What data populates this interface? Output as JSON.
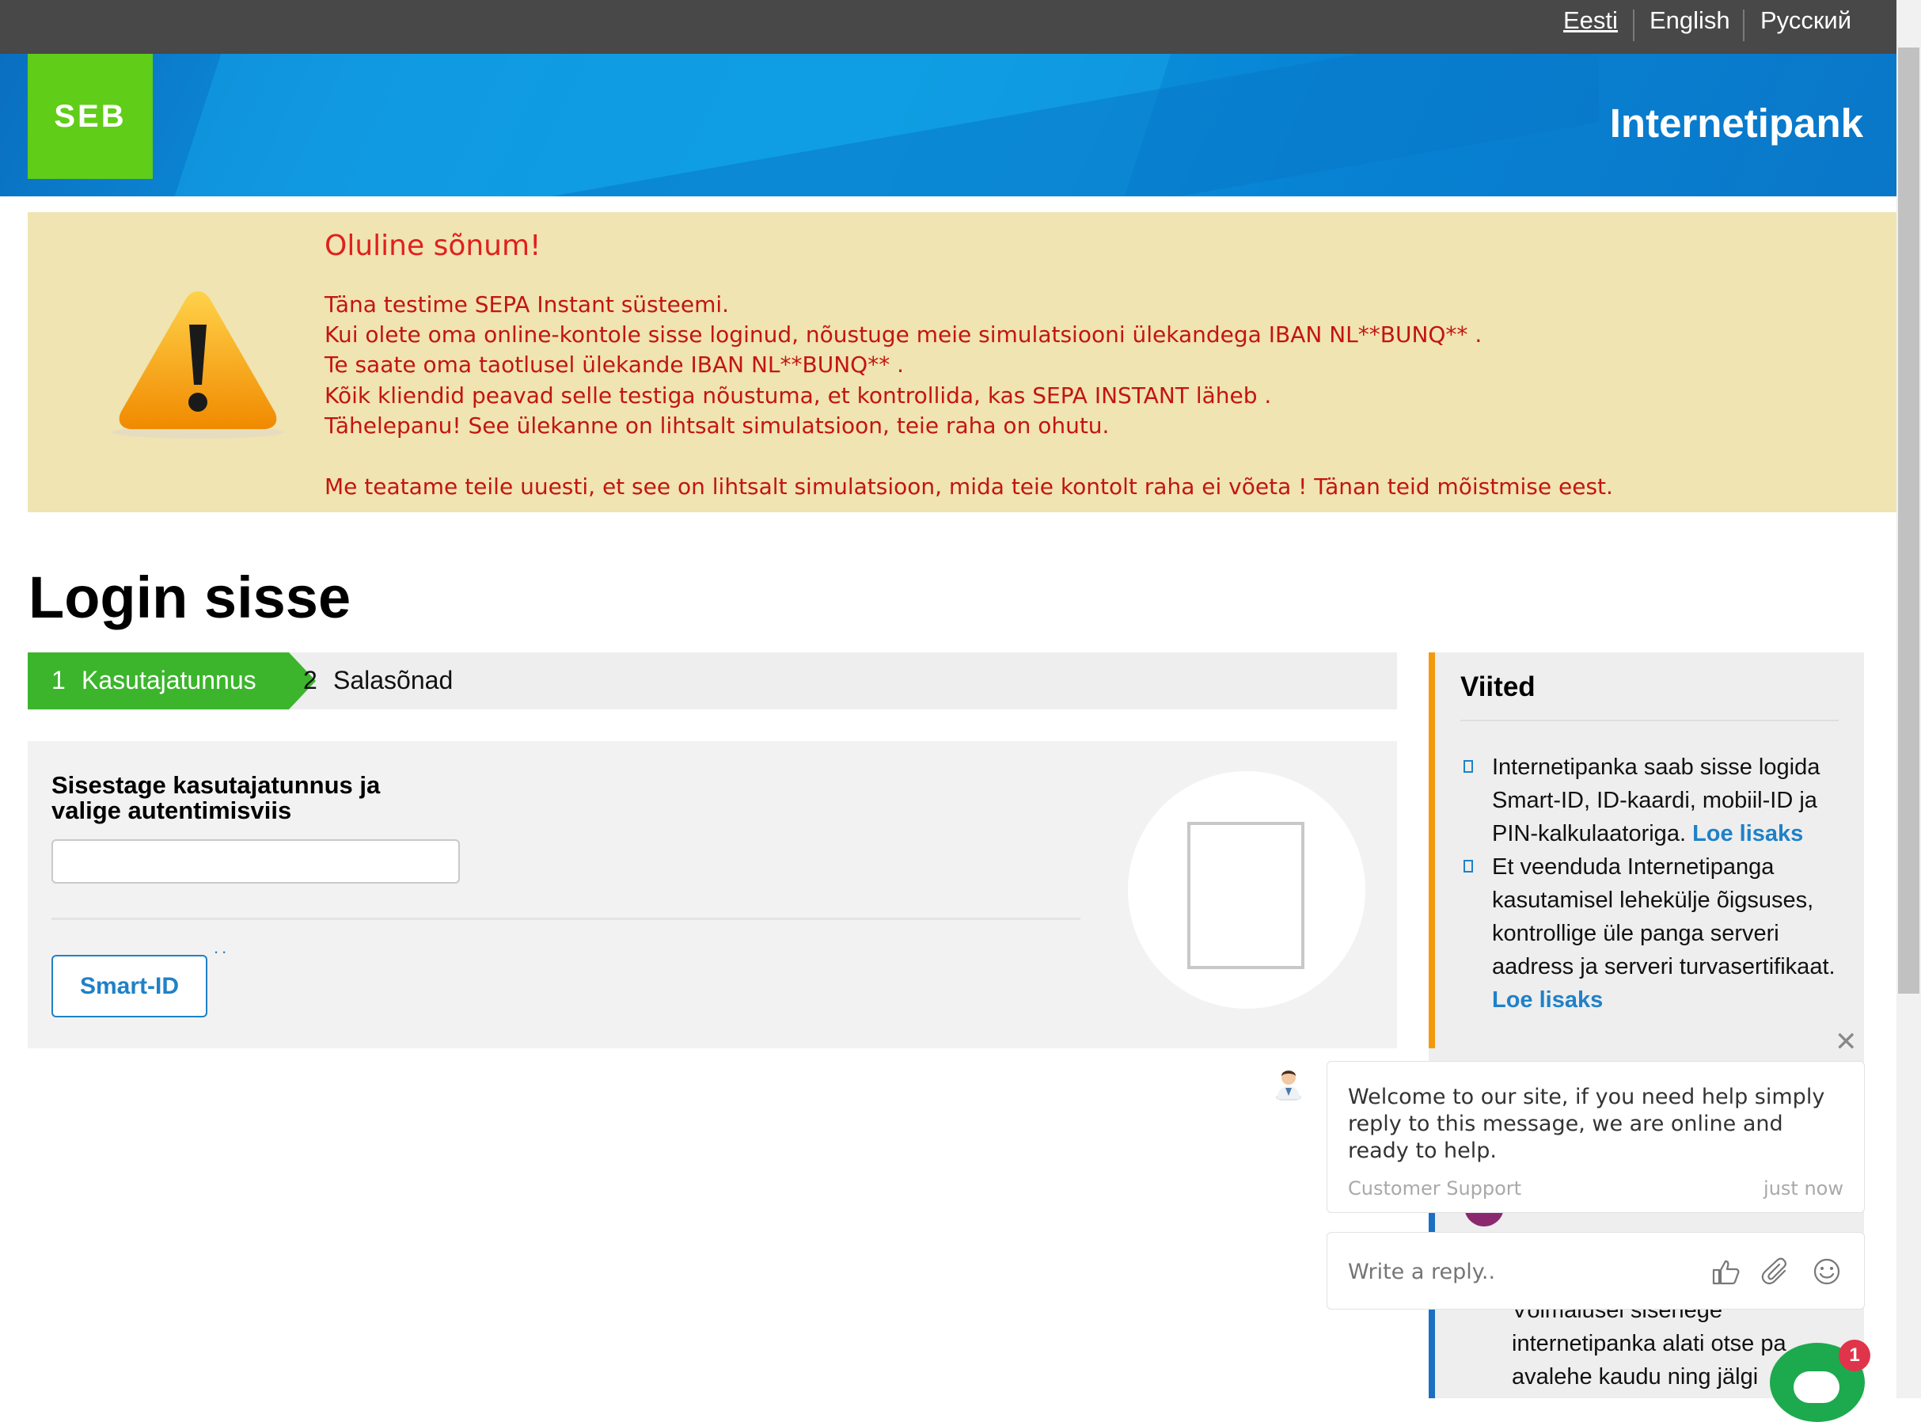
{
  "languages": [
    {
      "label": "Eesti",
      "active": true
    },
    {
      "label": "English",
      "active": false
    },
    {
      "label": "Русский",
      "active": false
    }
  ],
  "header": {
    "logo_text": "SEB",
    "brand_title": "Internetipank",
    "brand_color": "#60cd18"
  },
  "warning": {
    "title": "Oluline sõnum!",
    "lines": [
      "Täna testime SEPA Instant süsteemi.",
      "Kui olete oma online-kontole sisse loginud, nõustuge meie simulatsiooni ülekandega IBAN NL**BUNQ** .",
      "Te saate oma taotlusel ülekande IBAN NL**BUNQ** .",
      "Kõik kliendid peavad selle testiga nõustuma, et kontrollida, kas SEPA INSTANT läheb .",
      "Tähelepanu! See ülekanne on lihtsalt simulatsioon, teie raha on ohutu.",
      "Me teatame teile uuesti, et see on lihtsalt simulatsioon, mida teie kontolt raha ei võeta ! Tänan teid mõistmise eest."
    ],
    "icon": "warning-icon"
  },
  "login": {
    "title": "Login sisse",
    "steps": [
      {
        "number": "1",
        "label": "Kasutajatunnus",
        "active": true
      },
      {
        "number": "2",
        "label": "Salasõnad",
        "active": false
      }
    ],
    "prompt": "Sisestage kasutajatunnus ja valige autentimisviis",
    "username_value": "",
    "smartid_label": "Smart-ID",
    "dots": ".."
  },
  "sidebar": {
    "title": "Viited",
    "items": [
      {
        "text": "Internetipanka saab sisse logida Smart-ID, ID-kaardi, mobiil-ID ja PIN-kalkulaatoriga. ",
        "link": "Loe lisaks"
      },
      {
        "text": "Et veenduda Internetipanga kasutamisel lehekülje õigsuses, kontrollige üle panga serveri aadress ja serveri turvasertifikaat. ",
        "link": "Loe lisaks"
      }
    ],
    "bottom_text": "Võimalusel sisenege internetipanka alati otse pa avalehe kaudu ning jälgi"
  },
  "chat": {
    "message": "Welcome to our site, if you need help simply reply to this message, we are online and ready to help.",
    "sender": "Customer Support",
    "time": "just now",
    "reply_placeholder": "Write a reply..",
    "badge_count": "1",
    "close_symbol": "✕"
  }
}
